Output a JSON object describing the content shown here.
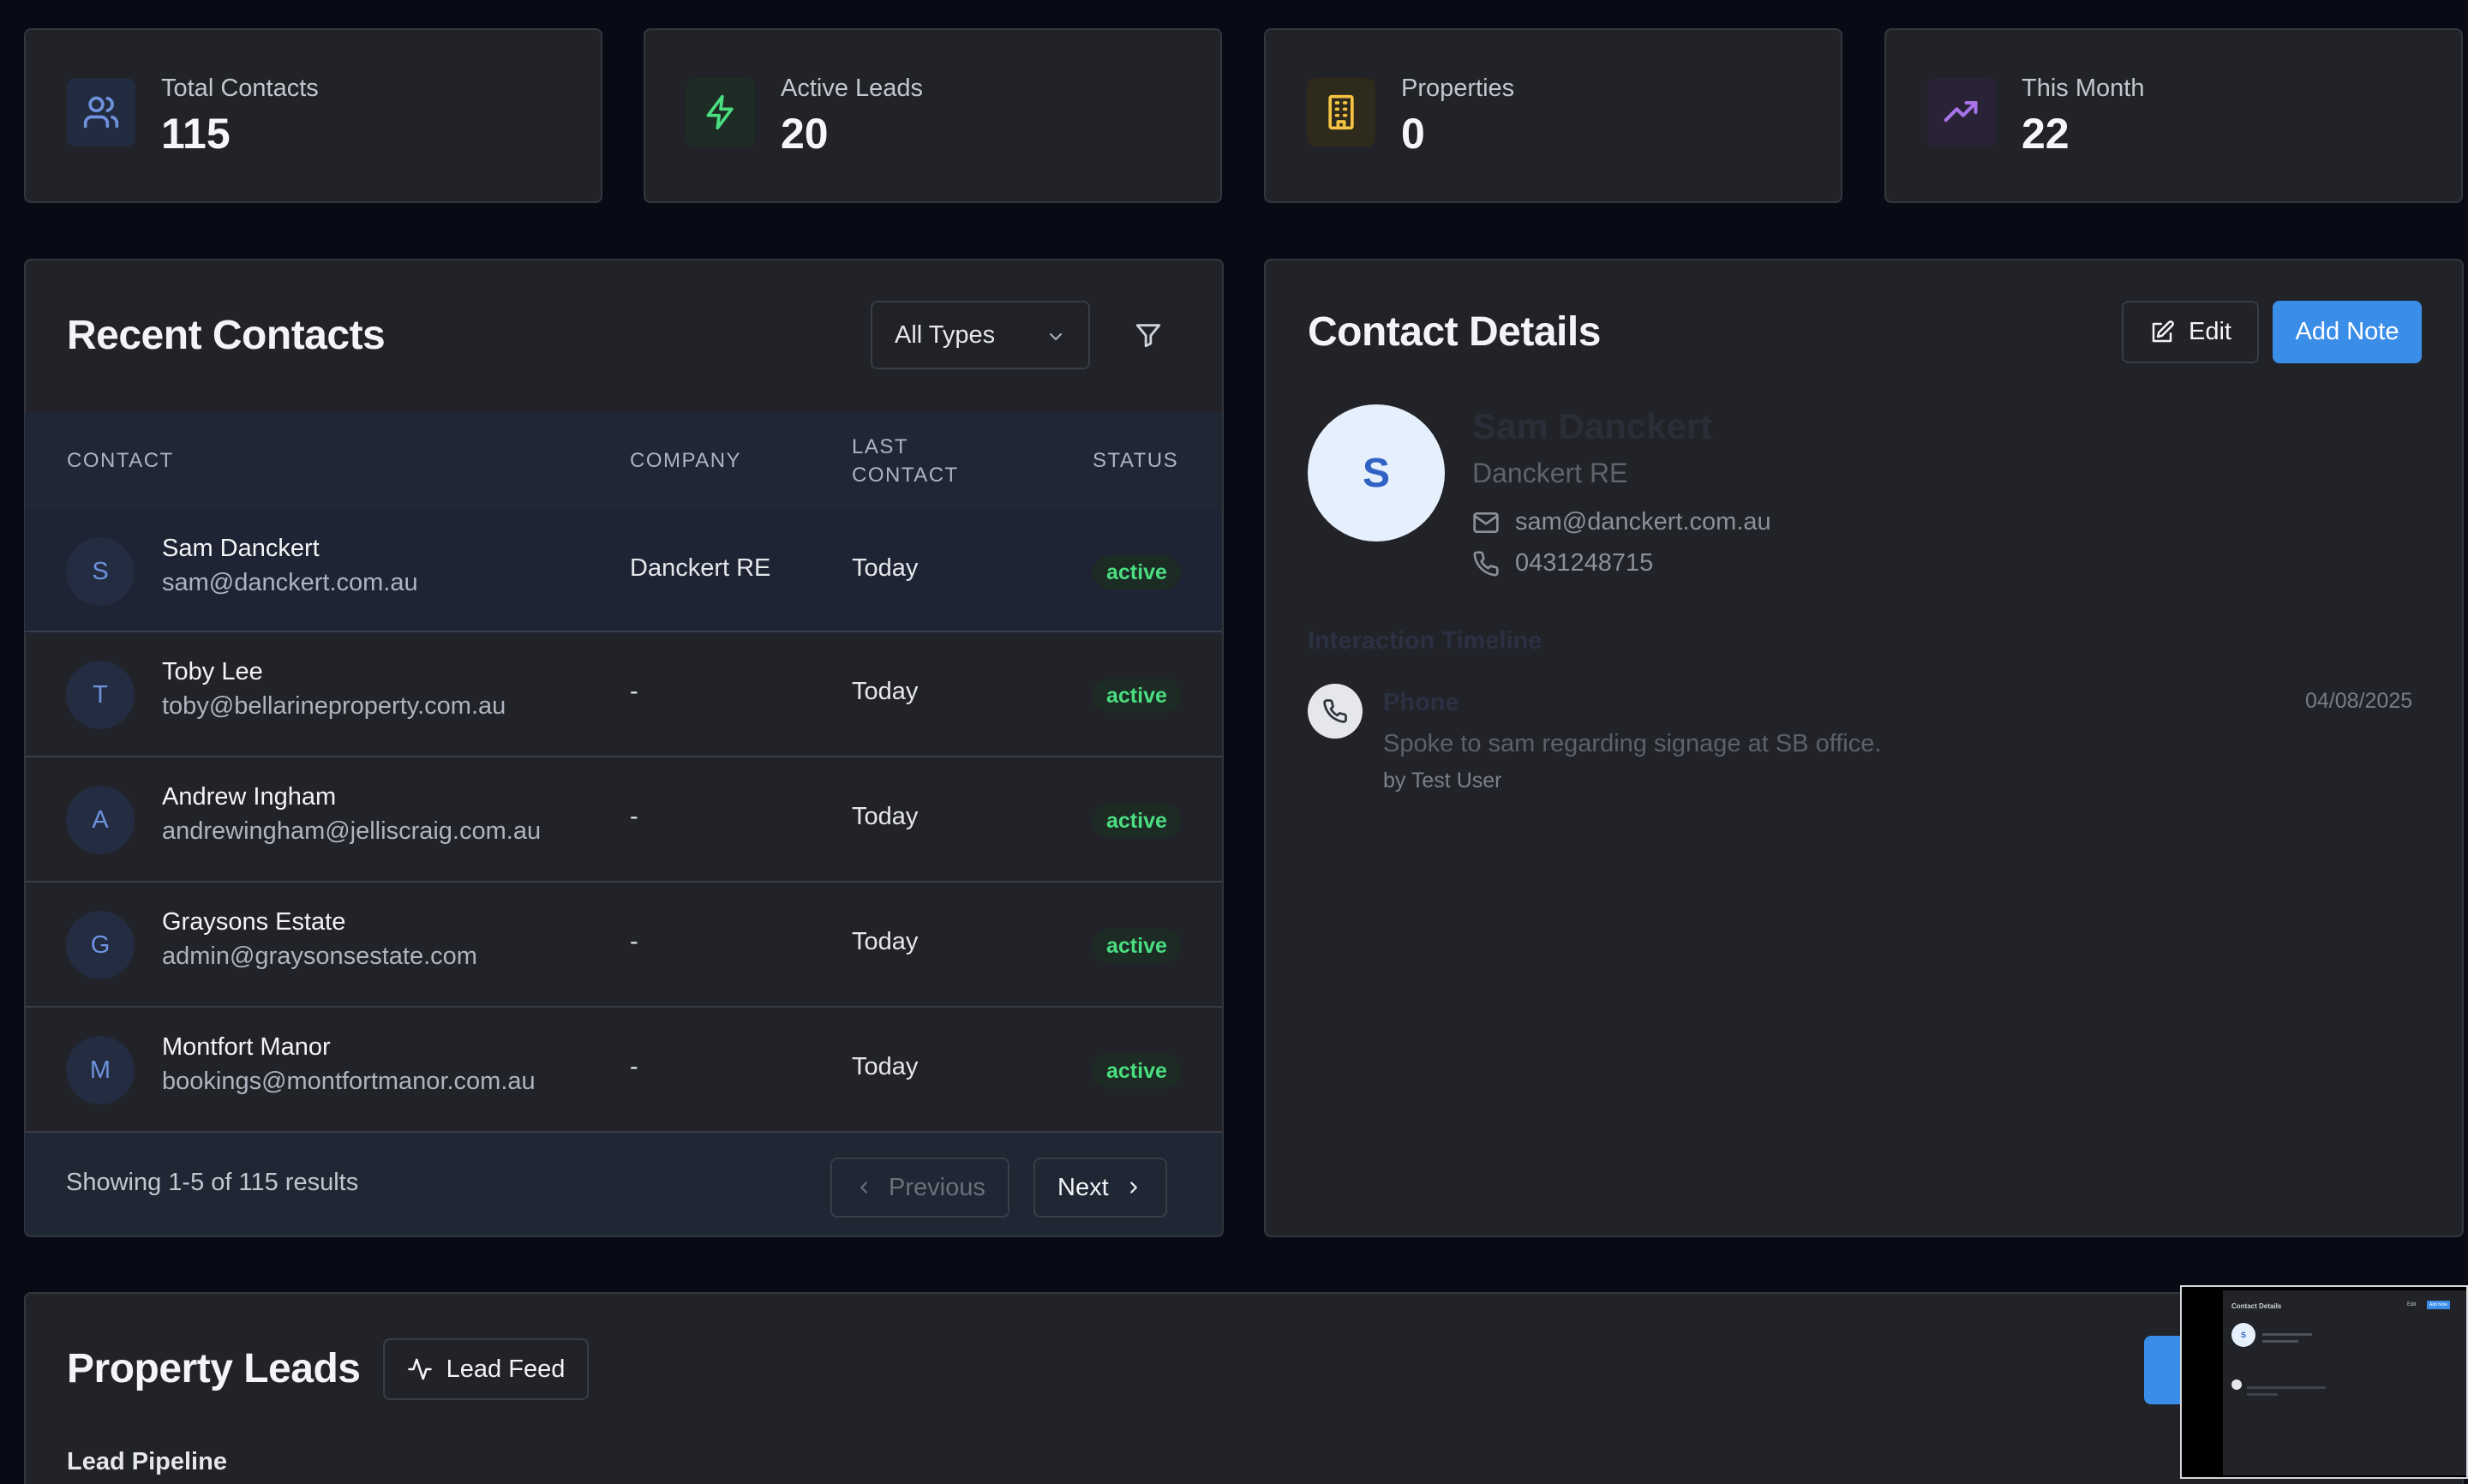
{
  "stats": [
    {
      "label": "Total Contacts",
      "value": "115",
      "icon": "users-icon",
      "color": "#6f92de"
    },
    {
      "label": "Active Leads",
      "value": "20",
      "icon": "lightning-icon",
      "color": "#4ade80"
    },
    {
      "label": "Properties",
      "value": "0",
      "icon": "building-icon",
      "color": "#f5c242"
    },
    {
      "label": "This Month",
      "value": "22",
      "icon": "trending-up-icon",
      "color": "#a875e8"
    }
  ],
  "contacts": {
    "title": "Recent Contacts",
    "filter_value": "All Types",
    "columns": {
      "contact": "CONTACT",
      "company": "COMPANY",
      "last_contact_1": "LAST",
      "last_contact_2": "CONTACT",
      "status": "STATUS"
    },
    "rows": [
      {
        "initial": "S",
        "name": "Sam Danckert",
        "email": "sam@danckert.com.au",
        "company": "Danckert RE",
        "last": "Today",
        "status": "active"
      },
      {
        "initial": "T",
        "name": "Toby Lee",
        "email": "toby@bellarineproperty.com.au",
        "company": "-",
        "last": "Today",
        "status": "active"
      },
      {
        "initial": "A",
        "name": "Andrew Ingham",
        "email": "andrewingham@jelliscraig.com.au",
        "company": "-",
        "last": "Today",
        "status": "active"
      },
      {
        "initial": "G",
        "name": "Graysons Estate",
        "email": "admin@graysonsestate.com",
        "company": "-",
        "last": "Today",
        "status": "active"
      },
      {
        "initial": "M",
        "name": "Montfort Manor",
        "email": "bookings@montfortmanor.com.au",
        "company": "-",
        "last": "Today",
        "status": "active"
      }
    ],
    "showing": "Showing 1-5 of 115 results",
    "prev_label": "Previous",
    "next_label": "Next"
  },
  "details": {
    "title": "Contact Details",
    "edit_label": "Edit",
    "add_note_label": "Add Note",
    "initial": "S",
    "name": "Sam Danckert",
    "company": "Danckert RE",
    "email": "sam@danckert.com.au",
    "phone": "0431248715",
    "timeline_heading": "Interaction Timeline",
    "timeline": [
      {
        "type": "Phone",
        "date": "04/08/2025",
        "text": "Spoke to sam regarding signage at SB office.",
        "by": "by Test User"
      }
    ]
  },
  "leads": {
    "title": "Property Leads",
    "feed_label": "Lead Feed",
    "pipeline_label": "Lead Pipeline"
  },
  "thumbnail": {
    "title": "Contact Details",
    "edit_label": "Edit",
    "add_note_label": "Add Note",
    "initial": "S"
  }
}
